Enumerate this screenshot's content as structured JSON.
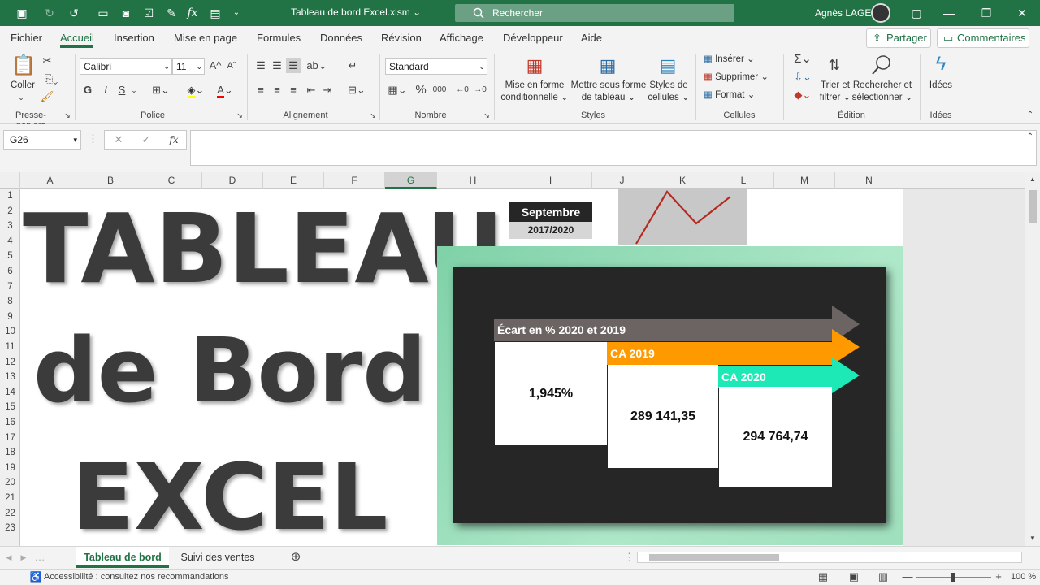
{
  "window": {
    "title": "Tableau de bord Excel.xlsm",
    "search_placeholder": "Rechercher",
    "user": "Agnès LAGE"
  },
  "menu": {
    "tabs": [
      "Fichier",
      "Accueil",
      "Insertion",
      "Mise en page",
      "Formules",
      "Données",
      "Révision",
      "Affichage",
      "Développeur",
      "Aide"
    ],
    "share": "Partager",
    "comments": "Commentaires"
  },
  "ribbon": {
    "clipboard": {
      "paste": "Coller",
      "label": "Presse-papiers"
    },
    "font": {
      "name": "Calibri",
      "size": "11",
      "bold": "G",
      "italic": "I",
      "underline": "S",
      "label": "Police"
    },
    "alignment": {
      "label": "Alignement"
    },
    "number": {
      "format": "Standard",
      "label": "Nombre"
    },
    "styles": {
      "conditional": "Mise en forme conditionnelle",
      "table": "Mettre sous forme de tableau",
      "cell_styles": "Styles de cellules",
      "label": "Styles"
    },
    "cells": {
      "insert": "Insérer",
      "delete": "Supprimer",
      "format": "Format",
      "label": "Cellules"
    },
    "editing": {
      "sort": "Trier et filtrer",
      "find": "Rechercher et sélectionner",
      "label": "Édition"
    },
    "ideas": {
      "btn": "Idées",
      "label": "Idées"
    }
  },
  "formula_bar": {
    "name_box": "G26",
    "content": ""
  },
  "columns": [
    "A",
    "B",
    "C",
    "D",
    "E",
    "F",
    "G",
    "H",
    "I",
    "J",
    "K",
    "L",
    "M",
    "N"
  ],
  "rows": [
    "1",
    "2",
    "3",
    "4",
    "5",
    "6",
    "7",
    "8",
    "9",
    "10",
    "11",
    "12",
    "13",
    "14",
    "15",
    "16",
    "17",
    "18",
    "19",
    "20",
    "21",
    "22",
    "23"
  ],
  "dashboard": {
    "title_line1": "TABLEAU",
    "title_line2": "de Bord",
    "title_line3": "EXCEL",
    "month": "Septembre",
    "years": "2017/2020",
    "ecart_label": "Écart en % 2020 et 2019",
    "ecart_value": "1,945%",
    "ca2019_label": "CA  2019",
    "ca2019_value": "289 141,35",
    "ca2020_label": "CA  2020",
    "ca2020_value": "294 764,74",
    "colors": {
      "ecart": "#6b6462",
      "ca2019": "#ff9900",
      "ca2020": "#1de9b6"
    }
  },
  "sheets": {
    "active": "Tableau de bord",
    "other": "Suivi des ventes"
  },
  "status": {
    "accessibility": "Accessibilité : consultez nos recommandations",
    "zoom": "100 %"
  }
}
